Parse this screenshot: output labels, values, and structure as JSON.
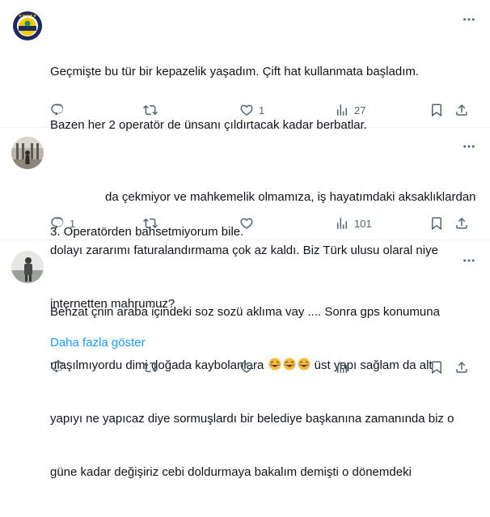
{
  "posts": [
    {
      "lines": [
        "Geçmişte bu tür bir kepazelik yaşadım. Çift hat kullanmata başladım.",
        "Bazen her 2 operatör de ünsanı çıldırtacak kadar berbatlar.",
        "",
        "3. Operatörden bahsetmiyorum bile."
      ],
      "reply_count": "",
      "repost_count": "",
      "like_count": "1",
      "view_count": "27"
    },
    {
      "lines": [
        "da çekmiyor ve mahkemelik olmamıza, iş hayatımdaki aksaklıklardan",
        "dolayı zararımı faturalandırmama çok az kaldı. Biz Türk ulusu olaral niye",
        "internetten mahrumuz?"
      ],
      "reply_count": "1",
      "repost_count": "",
      "like_count": "",
      "view_count": "101"
    },
    {
      "line1": "Behzat çnin araba içindeki soz sozü aklıma vay .... Sonra gps konumuna",
      "line2_before": "ulaşılmıyordu dimi doğada kaybolanlara",
      "line2_after": " üst yapı sağlam da alt",
      "line3": "yapıyı ne yapıcaz diye sormuşlardı bir belediye başkanına zamanında biz o",
      "line4": "güne kadar değişiriz cebi doldurmaya bakalım demişti o dönemdeki",
      "show_more": "Daha fazla göster"
    }
  ],
  "icons": [
    "more-icon",
    "reply-icon",
    "repost-icon",
    "like-icon",
    "views-icon",
    "bookmark-icon",
    "share-icon",
    "rofl-emoji"
  ],
  "colors": {
    "text": "#0f1419",
    "muted": "#536471",
    "link": "#1d9bf0",
    "divider": "#eff3f4",
    "fb_navy": "#1e2a5a",
    "fb_yellow": "#f6c90e"
  }
}
